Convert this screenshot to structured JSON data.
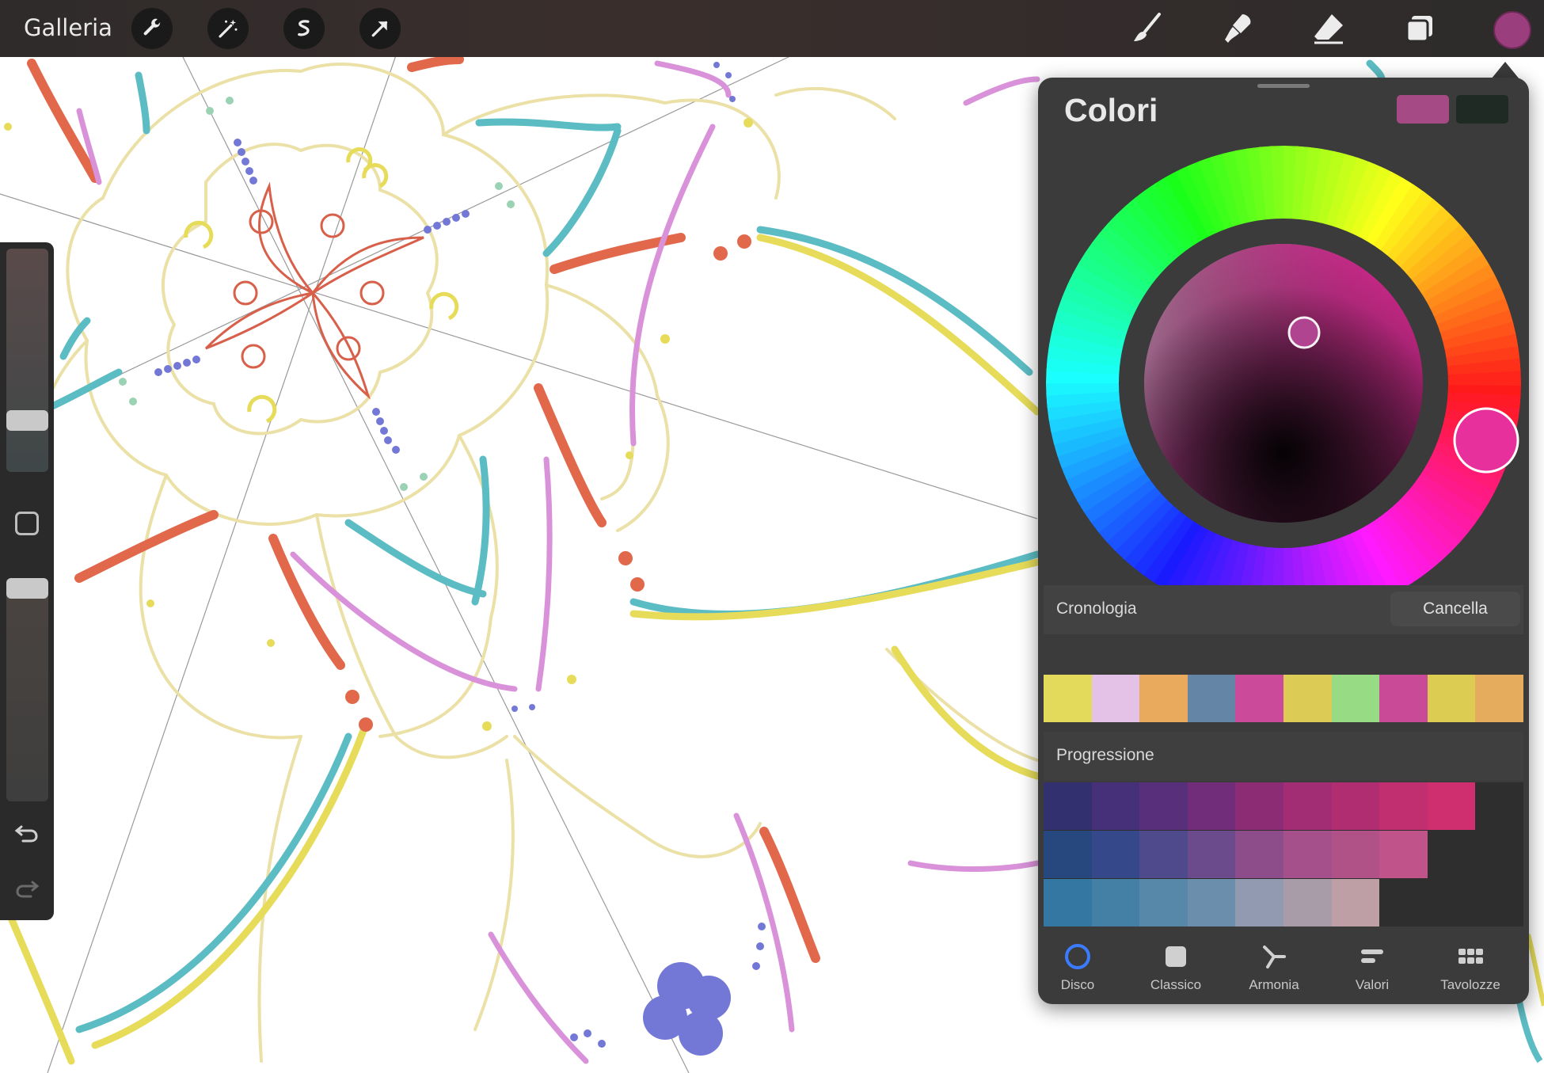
{
  "topbar": {
    "gallery_label": "Galleria",
    "tools_left": [
      "wrench-icon",
      "magic-wand-icon",
      "selection-icon",
      "transform-arrow-icon"
    ],
    "tools_right": [
      "brush-icon",
      "smudge-icon",
      "eraser-icon",
      "layers-icon"
    ],
    "current_color": "#9b3e7d"
  },
  "sidebar": {
    "size_slider": "brush-size",
    "opacity_slider": "brush-opacity",
    "buttons": [
      "modify-button",
      "undo-icon",
      "redo-icon"
    ]
  },
  "colors_panel": {
    "title": "Colori",
    "primary_color": "#a64a86",
    "secondary_color": "#1f2a25",
    "history": {
      "label": "Cronologia",
      "clear_label": "Cancella",
      "swatches": [
        "#e3d95a",
        "#e4c2e8",
        "#e9aa5e",
        "#6485a5",
        "#cc4a9a",
        "#dccc56",
        "#97dc84",
        "#c94b98",
        "#ddcc52",
        "#e6ac5e"
      ]
    },
    "progression": {
      "label": "Progressione",
      "rows": [
        [
          "#33306f",
          "#46307a",
          "#572f7b",
          "#712d7a",
          "#8c2c75",
          "#a22d75",
          "#b02d72",
          "#c12f70",
          "#cf2f6f"
        ],
        [
          "#27487f",
          "#35488a",
          "#4f4a8c",
          "#6b4b8b",
          "#8d4d8a",
          "#a5508b",
          "#b05288",
          "#c0538a"
        ],
        [
          "#3577a3",
          "#4480a6",
          "#5888a9",
          "#6a8eab",
          "#929ab2",
          "#a99ca9",
          "#be9fa5"
        ]
      ]
    },
    "tabs": [
      {
        "label": "Disco",
        "icon": "disc-icon"
      },
      {
        "label": "Classico",
        "icon": "square-icon"
      },
      {
        "label": "Armonia",
        "icon": "harmony-icon"
      },
      {
        "label": "Valori",
        "icon": "sliders-icon"
      },
      {
        "label": "Tavolozze",
        "icon": "palettes-grid-icon"
      }
    ],
    "active_tab": "Disco"
  }
}
